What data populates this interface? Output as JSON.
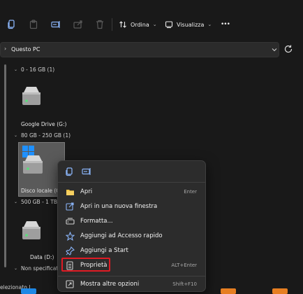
{
  "toolbar": {
    "sort_label": "Ordina",
    "view_label": "Visualizza",
    "more_label": "•••"
  },
  "address": {
    "path": "Questo PC"
  },
  "groups": [
    {
      "label": "0 - 16 GB (1)"
    },
    {
      "label": "80 GB - 250 GB (1)"
    },
    {
      "label": "500 GB - 1 TB ("
    },
    {
      "label": "Non specificato"
    }
  ],
  "drives": [
    {
      "label": "Google Drive (G:)"
    },
    {
      "label": "Disco locale (C"
    },
    {
      "label": "Data (D:)"
    }
  ],
  "context_menu": {
    "items": [
      {
        "label": "Apri",
        "shortcut": "Enter"
      },
      {
        "label": "Apri in una nuova finestra",
        "shortcut": ""
      },
      {
        "label": "Formatta...",
        "shortcut": ""
      },
      {
        "label": "Aggiungi ad Accesso rapido",
        "shortcut": ""
      },
      {
        "label": "Aggiungi a Start",
        "shortcut": ""
      },
      {
        "label": "Proprietà",
        "shortcut": "ALT+Enter"
      },
      {
        "label": "Mostra altre opzioni",
        "shortcut": "Shift+F10"
      }
    ]
  },
  "status": {
    "text": "elezionato  |"
  },
  "colors": {
    "highlight": "#e01b24",
    "accent": "#0078d4"
  }
}
